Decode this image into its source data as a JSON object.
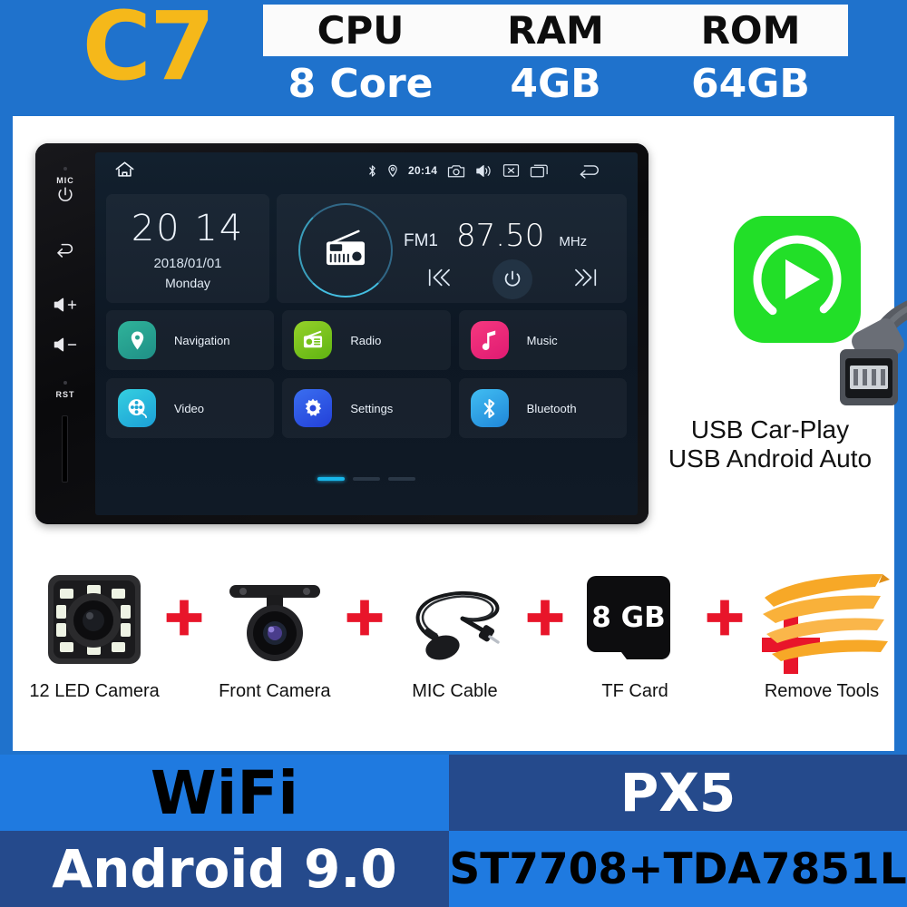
{
  "header": {
    "model": "C7",
    "specs": [
      {
        "label": "CPU",
        "value": "8 Core"
      },
      {
        "label": "RAM",
        "value": "4GB"
      },
      {
        "label": "ROM",
        "value": "64GB"
      }
    ]
  },
  "head_unit": {
    "bezel_buttons": [
      {
        "name": "mic",
        "label": "MIC"
      },
      {
        "name": "power",
        "label": ""
      },
      {
        "name": "back",
        "label": ""
      },
      {
        "name": "volume-up",
        "label": ""
      },
      {
        "name": "volume-down",
        "label": ""
      },
      {
        "name": "reset",
        "label": "RST"
      }
    ],
    "status_bar": {
      "time": "20:14",
      "icons": [
        "bluetooth-icon",
        "location-icon",
        "camera-icon",
        "volume-icon",
        "mute-icon",
        "recents-icon",
        "back-icon"
      ]
    },
    "home_icon": "home-icon",
    "clock": {
      "time": "20 14",
      "date": "2018/01/01",
      "weekday": "Monday"
    },
    "radio": {
      "band": "FM1",
      "frequency": "87.50",
      "unit": "MHz",
      "prev_icon": "previous-icon",
      "power_icon": "power-icon",
      "next_icon": "next-icon",
      "app_icon": "radio-icon"
    },
    "apps": [
      {
        "label": "Navigation",
        "icon": "location-pin-icon"
      },
      {
        "label": "Radio",
        "icon": "radio-icon"
      },
      {
        "label": "Music",
        "icon": "music-note-icon"
      },
      {
        "label": "Video",
        "icon": "film-reel-icon"
      },
      {
        "label": "Settings",
        "icon": "gear-icon"
      },
      {
        "label": "Bluetooth",
        "icon": "bluetooth-icon"
      }
    ],
    "pages": {
      "count": 3,
      "active": 1
    }
  },
  "carplay": {
    "icon": "carplay-icon",
    "cable_icon": "usb-cable-icon",
    "line1": "USB Car-Play",
    "line2": "USB Android Auto",
    "plus": "+"
  },
  "accessories": {
    "plus": "+",
    "items": [
      {
        "label": "12 LED Camera",
        "icon": "led-camera-icon"
      },
      {
        "label": "Front Camera",
        "icon": "front-camera-icon"
      },
      {
        "label": "MIC Cable",
        "icon": "microphone-cable-icon"
      },
      {
        "label": "TF Card",
        "icon": "tf-card-icon",
        "capacity": "8 GB"
      },
      {
        "label": "Remove Tools",
        "icon": "pry-tools-icon"
      }
    ]
  },
  "footer": {
    "wifi": "WiFi",
    "cpu_platform": "PX5",
    "android": "Android 9.0",
    "chipset": "ST7708+TDA7851L"
  },
  "colors": {
    "brand_blue": "#1f72cc",
    "model_yellow": "#f5b81a",
    "plus_red": "#e8152a",
    "footer_light": "#1f7ae0",
    "footer_dark": "#254a8c",
    "carplay_green": "#22df28"
  }
}
